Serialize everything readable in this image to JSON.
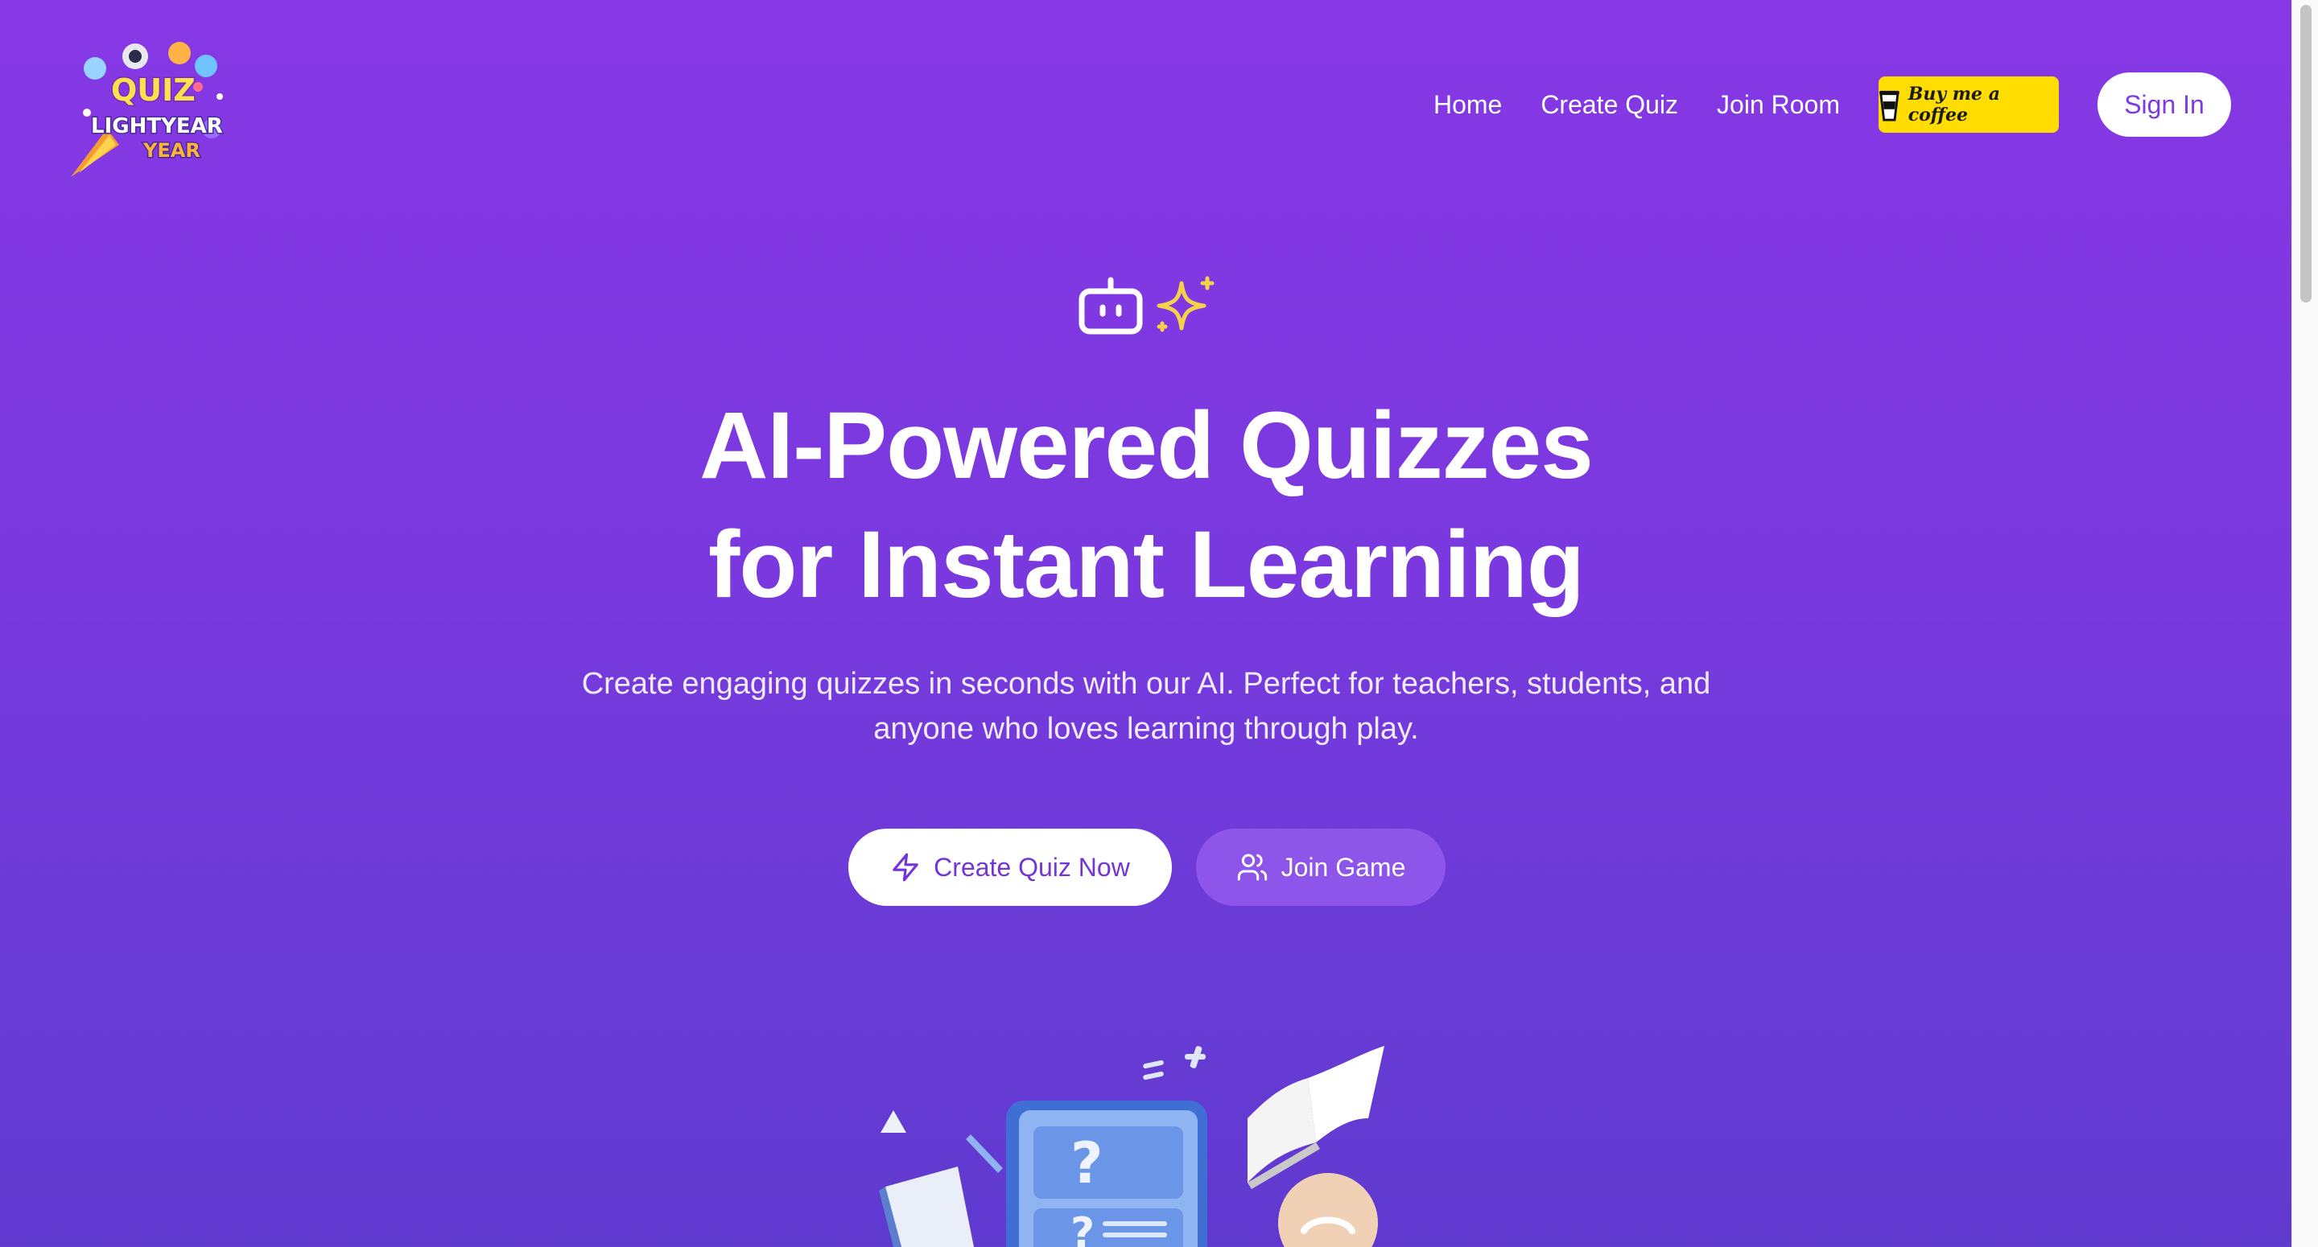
{
  "logo": {
    "line1": "QUIZ",
    "line2": "LIGHTYEAR",
    "line3": "YEAR"
  },
  "nav": {
    "home": "Home",
    "create_quiz": "Create Quiz",
    "join_room": "Join Room",
    "coffee": "Buy me a coffee",
    "sign_in": "Sign In"
  },
  "hero": {
    "icons": [
      "bot-icon",
      "sparkles-icon"
    ],
    "title_line1": "AI-Powered Quizzes",
    "title_line2": "for Instant Learning",
    "subtitle_line1": "Create engaging quizzes in seconds with our AI. Perfect for teachers, students, and",
    "subtitle_line2": "anyone who loves learning through play.",
    "primary_cta": "Create Quiz Now",
    "secondary_cta": "Join Game"
  },
  "colors": {
    "background_top": "#8638e4",
    "background_bottom": "#5f3acf",
    "accent_purple": "#7c3ae0",
    "coffee_yellow": "#ffdd00",
    "sparkle_yellow": "#f5d04a"
  }
}
